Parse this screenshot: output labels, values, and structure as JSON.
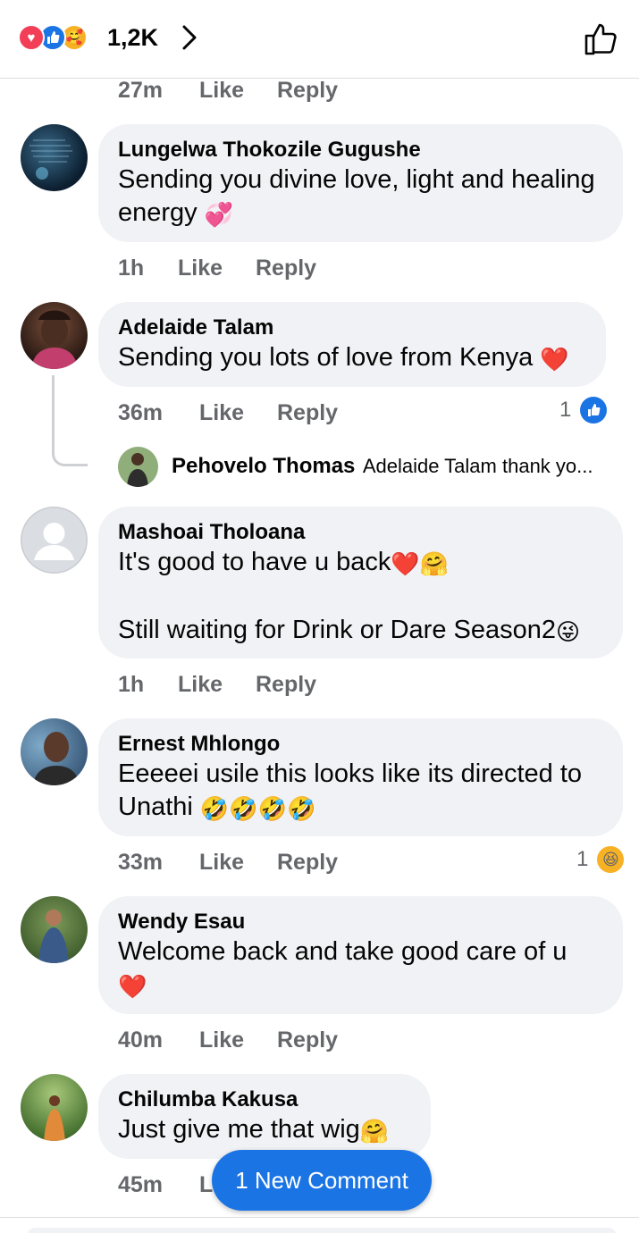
{
  "header": {
    "reaction_count": "1,2K",
    "reaction_icons": [
      "love",
      "like",
      "care"
    ]
  },
  "top_meta": {
    "time": "27m",
    "like": "Like",
    "reply": "Reply"
  },
  "comments": [
    {
      "author": "Lungelwa Thokozile Gugushe",
      "text": "Sending you divine love, light and healing energy",
      "emoji": "💞",
      "time": "1h",
      "like": "Like",
      "reply": "Reply"
    },
    {
      "author": "Adelaide Talam",
      "text": "Sending you lots of love from Kenya",
      "emoji": "❤️",
      "time": "36m",
      "like": "Like",
      "reply": "Reply",
      "reaction_count": "1"
    },
    {
      "author": "Mashoai Tholoana",
      "text_line1": "It's good to have u back",
      "emoji1": "❤️🤗",
      "text_line2": "Still waiting for Drink or Dare Season2",
      "emoji2": "😜",
      "time": "1h",
      "like": "Like",
      "reply": "Reply"
    },
    {
      "author": "Ernest Mhlongo",
      "text": "Eeeeei usile this looks like its directed to Unathi",
      "emoji": "🤣🤣🤣🤣",
      "time": "33m",
      "like": "Like",
      "reply": "Reply",
      "reaction_count": "1"
    },
    {
      "author": "Wendy Esau",
      "text": "Welcome back and take good care of u",
      "emoji": "❤️",
      "time": "40m",
      "like": "Like",
      "reply": "Reply"
    },
    {
      "author": "Chilumba Kakusa",
      "text": "Just give me that wig",
      "emoji": "🤗",
      "time": "45m",
      "like": "L"
    }
  ],
  "reply_preview": {
    "author": "Pehovelo Thomas",
    "snippet": "Adelaide Talam thank yo..."
  },
  "new_comment_button": "1 New Comment",
  "colors": {
    "accent": "#1b74e4",
    "bubble": "#f0f2f5",
    "meta": "#65676b"
  }
}
